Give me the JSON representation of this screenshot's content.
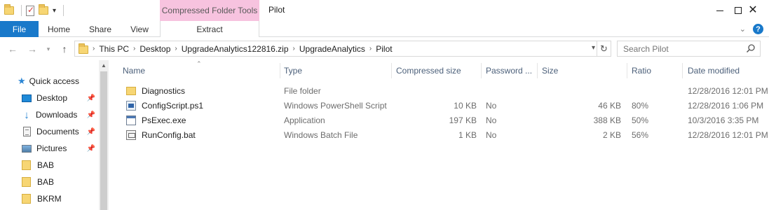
{
  "window": {
    "title": "Pilot",
    "context_tab": "Compressed Folder Tools"
  },
  "ribbon": {
    "tabs": [
      "File",
      "Home",
      "Share",
      "View"
    ],
    "context_subtab": "Extract",
    "help_label": "?"
  },
  "address": {
    "crumbs": [
      "This PC",
      "Desktop",
      "UpgradeAnalytics122816.zip",
      "UpgradeAnalytics",
      "Pilot"
    ]
  },
  "search": {
    "placeholder": "Search Pilot"
  },
  "nav_pane": {
    "items": [
      {
        "label": "Quick access",
        "icon": "star-icon",
        "pinned": false
      },
      {
        "label": "Desktop",
        "icon": "desktop-icon",
        "pinned": true
      },
      {
        "label": "Downloads",
        "icon": "download-arrow-icon",
        "pinned": true
      },
      {
        "label": "Documents",
        "icon": "documents-icon",
        "pinned": true
      },
      {
        "label": "Pictures",
        "icon": "pictures-icon",
        "pinned": true
      },
      {
        "label": "BAB",
        "icon": "folder-icon",
        "pinned": false
      },
      {
        "label": "BAB",
        "icon": "folder-icon",
        "pinned": false
      },
      {
        "label": "BKRM",
        "icon": "folder-icon",
        "pinned": false
      }
    ]
  },
  "columns": [
    "Name",
    "Type",
    "Compressed size",
    "Password ...",
    "Size",
    "Ratio",
    "Date modified"
  ],
  "files": [
    {
      "name": "Diagnostics",
      "type": "File folder",
      "compressed": "",
      "password": "",
      "size": "",
      "ratio": "",
      "date": "12/28/2016 12:01 PM",
      "icon": "folder-icon"
    },
    {
      "name": "ConfigScript.ps1",
      "type": "Windows PowerShell Script",
      "compressed": "10 KB",
      "password": "No",
      "size": "46 KB",
      "ratio": "80%",
      "date": "12/28/2016 1:06 PM",
      "icon": "powershell-script-icon"
    },
    {
      "name": "PsExec.exe",
      "type": "Application",
      "compressed": "197 KB",
      "password": "No",
      "size": "388 KB",
      "ratio": "50%",
      "date": "10/3/2016 3:35 PM",
      "icon": "application-icon"
    },
    {
      "name": "RunConfig.bat",
      "type": "Windows Batch File",
      "compressed": "1 KB",
      "password": "No",
      "size": "2 KB",
      "ratio": "56%",
      "date": "12/28/2016 12:01 PM",
      "icon": "batch-file-icon"
    }
  ],
  "colors": {
    "file_tab": "#1979ca",
    "context_tab": "#f7c3df",
    "header_text": "#4c607a",
    "folder": "#f7d674"
  }
}
